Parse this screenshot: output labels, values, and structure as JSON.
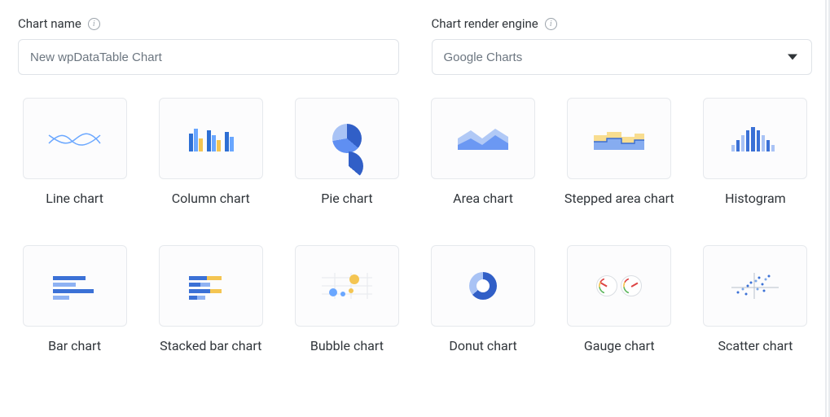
{
  "form": {
    "name_label": "Chart name",
    "name_value": "New wpDataTable Chart",
    "engine_label": "Chart render engine",
    "engine_value": "Google Charts"
  },
  "chart_types": [
    {
      "id": "line",
      "label": "Line chart"
    },
    {
      "id": "column",
      "label": "Column chart"
    },
    {
      "id": "pie",
      "label": "Pie chart"
    },
    {
      "id": "area",
      "label": "Area chart"
    },
    {
      "id": "stepped-area",
      "label": "Stepped area chart"
    },
    {
      "id": "histogram",
      "label": "Histogram"
    },
    {
      "id": "bar",
      "label": "Bar chart"
    },
    {
      "id": "stacked-bar",
      "label": "Stacked bar chart"
    },
    {
      "id": "bubble",
      "label": "Bubble chart"
    },
    {
      "id": "donut",
      "label": "Donut chart"
    },
    {
      "id": "gauge",
      "label": "Gauge chart"
    },
    {
      "id": "scatter",
      "label": "Scatter chart"
    }
  ]
}
